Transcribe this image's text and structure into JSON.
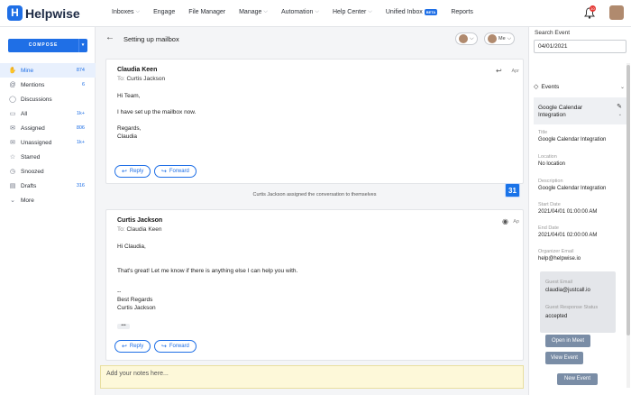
{
  "app": {
    "logo_text": "Helpwise",
    "logo_mark": "H"
  },
  "nav": {
    "items": [
      {
        "label": "Inboxes",
        "dropdown": true
      },
      {
        "label": "Engage",
        "dropdown": false
      },
      {
        "label": "File Manager",
        "dropdown": false
      },
      {
        "label": "Manage",
        "dropdown": true
      },
      {
        "label": "Automation",
        "dropdown": true
      },
      {
        "label": "Help Center",
        "dropdown": true
      },
      {
        "label": "Unified Inbox",
        "dropdown": false,
        "badge": "BETA"
      },
      {
        "label": "Reports",
        "dropdown": false
      }
    ],
    "notification_count": "10"
  },
  "sidebar": {
    "compose_label": "COMPOSE",
    "items": [
      {
        "label": "Mine",
        "count": "874",
        "icon": "hand-icon",
        "active": true
      },
      {
        "label": "Mentions",
        "count": "6",
        "icon": "at-icon"
      },
      {
        "label": "Discussions",
        "count": "",
        "icon": "chat-icon"
      },
      {
        "label": "All",
        "count": "1k+",
        "icon": "inbox-icon"
      },
      {
        "label": "Assigned",
        "count": "806",
        "icon": "assigned-icon"
      },
      {
        "label": "Unassigned",
        "count": "1k+",
        "icon": "unassigned-icon"
      },
      {
        "label": "Starred",
        "count": "",
        "icon": "star-icon"
      },
      {
        "label": "Snoozed",
        "count": "",
        "icon": "clock-icon"
      },
      {
        "label": "Drafts",
        "count": "316",
        "icon": "draft-icon"
      },
      {
        "label": "More",
        "count": "",
        "icon": "chevron-down-icon"
      }
    ]
  },
  "conversation": {
    "title": "Setting up mailbox",
    "assignee_me": "Me",
    "messages": [
      {
        "sender": "Claudia Keen",
        "to_label": "To:",
        "to": "Curtis Jackson",
        "date": "Apr",
        "lines": [
          "Hi Team,",
          "",
          "I have set up the mailbox now.",
          "",
          "Regards,",
          "Claudia"
        ],
        "reply_label": "Reply",
        "forward_label": "Forward"
      },
      {
        "sender": "Curtis Jackson",
        "to_label": "To:",
        "to": "Claudia Keen",
        "date": "Ap",
        "lines": [
          "Hi Claudia,",
          "",
          "",
          "That's great! Let me know if there is anything else I can help you with.",
          "",
          "",
          "--",
          "Best Regards",
          "Curtis Jackson"
        ],
        "reply_label": "Reply",
        "forward_label": "Forward"
      }
    ],
    "system_note": "Curtis Jackson assigned the conversation to themselves",
    "calendar_badge": "31",
    "notes_placeholder": "Add your notes here..."
  },
  "right_panel": {
    "search_label": "Search Event",
    "search_value": "04/01/2021",
    "events_header": "Events",
    "event": {
      "title": "Google Calendar Integration",
      "fields": [
        {
          "label": "Title",
          "value": "Google Calendar Integration"
        },
        {
          "label": "Location",
          "value": "No location"
        },
        {
          "label": "Description",
          "value": "Google Calendar Integration"
        },
        {
          "label": "Start Date",
          "value": "2021/04/01 01:00:00 AM"
        },
        {
          "label": "End Date",
          "value": "2021/04/01 02:00:00 AM"
        },
        {
          "label": "Organizer Email",
          "value": "help@helpwise.io"
        }
      ],
      "guest_email_label": "Guest Email",
      "guest_email": "claudia@justcall.io",
      "guest_status_label": "Guest Response Status",
      "guest_status": "accepted",
      "open_meet_label": "Open in Meet",
      "view_event_label": "View Event"
    },
    "new_event_label": "New Event"
  },
  "colors": {
    "accent": "#1f6fe6",
    "notes_bg": "#fdf8d9",
    "panel_button": "#7a8da6"
  }
}
